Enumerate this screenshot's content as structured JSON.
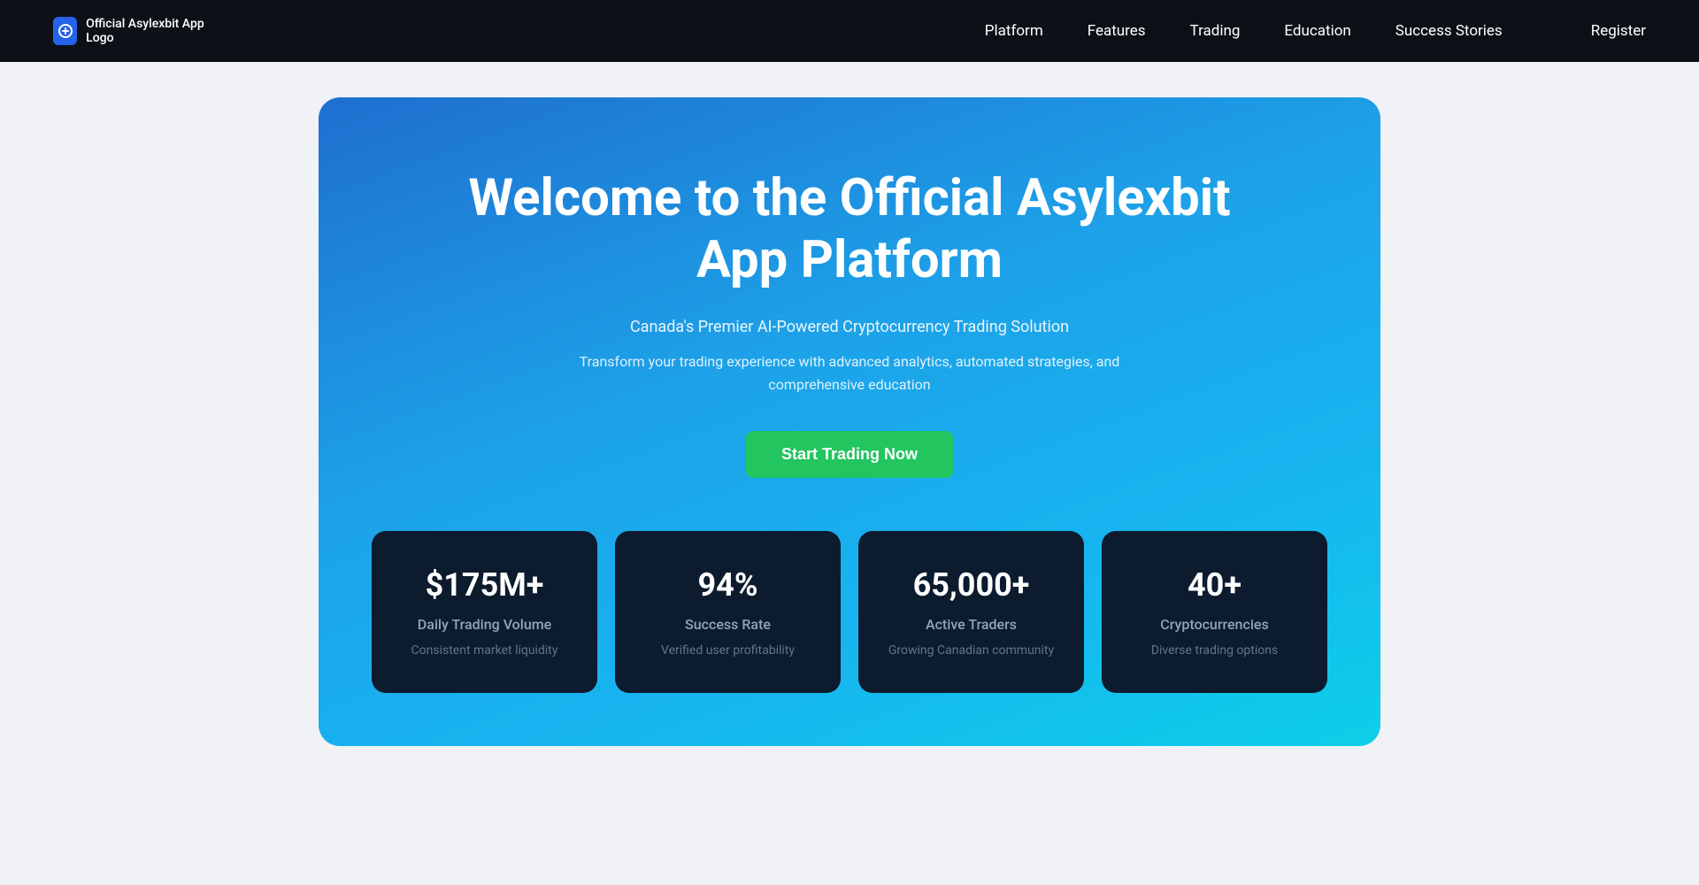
{
  "navbar": {
    "logo_alt": "Official Asylexbit App Logo",
    "logo_text": "Official Asylexbit App Logo",
    "nav_items": [
      {
        "label": "Platform",
        "id": "platform"
      },
      {
        "label": "Features",
        "id": "features"
      },
      {
        "label": "Trading",
        "id": "trading"
      },
      {
        "label": "Education",
        "id": "education"
      },
      {
        "label": "Success Stories",
        "id": "success-stories"
      }
    ],
    "register_label": "Register"
  },
  "hero": {
    "title": "Welcome to the Official Asylexbit App Platform",
    "subtitle": "Canada's Premier AI-Powered Cryptocurrency Trading Solution",
    "description": "Transform your trading experience with advanced analytics, automated strategies, and comprehensive education",
    "cta_label": "Start Trading Now"
  },
  "stats": [
    {
      "value": "$175M+",
      "label": "Daily Trading Volume",
      "description": "Consistent market liquidity"
    },
    {
      "value": "94%",
      "label": "Success Rate",
      "description": "Verified user profitability"
    },
    {
      "value": "65,000+",
      "label": "Active Traders",
      "description": "Growing Canadian community"
    },
    {
      "value": "40+",
      "label": "Cryptocurrencies",
      "description": "Diverse trading options"
    }
  ]
}
